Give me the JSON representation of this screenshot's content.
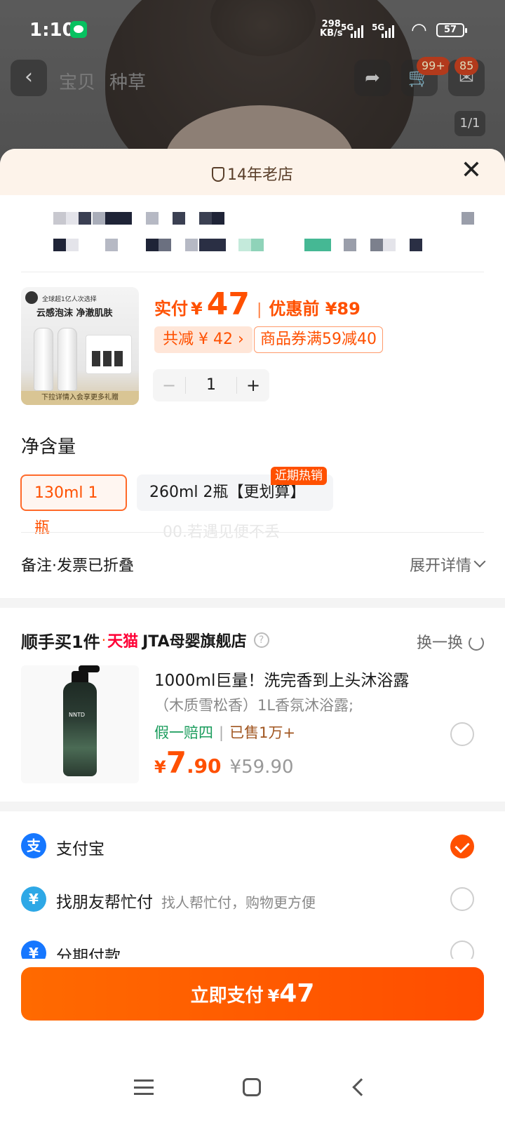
{
  "status_bar": {
    "time": "1:10",
    "speed": "298",
    "speed_unit": "KB/s",
    "signal1": "5G",
    "signal2": "5G",
    "battery": "57"
  },
  "top_bar": {
    "tabs": [
      "宝贝",
      "种草"
    ],
    "cart_badge": "99+",
    "msg_badge": "85",
    "pager": "1/1"
  },
  "sheet": {
    "store_tag": "14年老店",
    "product_image": {
      "top_line": "全球超1亿人次选择",
      "headline": "云感泡沫 净澈肌肤",
      "footer": "下拉详情入会享更多礼赠"
    },
    "price": {
      "paid_label": "实付",
      "yen": "¥",
      "paid_value": "47",
      "sep": "|",
      "before_label": "优惠前 ¥89"
    },
    "discount_chip": "共减 ¥ 42 ›",
    "coupon_chip": "商品券满59减40",
    "stepper": {
      "minus": "−",
      "value": "1",
      "plus": "+"
    },
    "spec_title": "净含量",
    "options": [
      "130ml 1瓶",
      "260ml 2瓶【更划算】"
    ],
    "hot_tag": "近期热销",
    "watermark": "00.若遇见便不丢",
    "note_left": "备注·发票已折叠",
    "note_right": "展开详情"
  },
  "add_on": {
    "brand": "顺手买1件",
    "dot": "·",
    "tmall": "天猫",
    "shop": "JTA母婴旗舰店",
    "help": "?",
    "swap": "换一换",
    "bottle_label": "NNTD",
    "title": "1000ml巨量！洗完香到上头沐浴露",
    "subtitle": "（木质雪松香）1L香氛沐浴露;",
    "tag1": "假一赔四",
    "tag_sep": "|",
    "tag2": "已售1万+",
    "price_yen": "¥",
    "price_int": "7",
    "price_dec": ".90",
    "price_orig": "¥59.90"
  },
  "payment": [
    {
      "name": "支付宝",
      "desc": "",
      "icon": "支",
      "color": "#1677ff",
      "selected": true
    },
    {
      "name": "找朋友帮忙付",
      "desc": "找人帮忙付，购物更方便",
      "icon": "¥",
      "color": "#2ea8e6",
      "selected": false
    },
    {
      "name": "分期付款",
      "desc": "",
      "icon": "¥",
      "color": "#1677ff",
      "selected": false
    }
  ],
  "pay_button": {
    "label": "立即支付",
    "yen": "¥",
    "amount": "47"
  }
}
